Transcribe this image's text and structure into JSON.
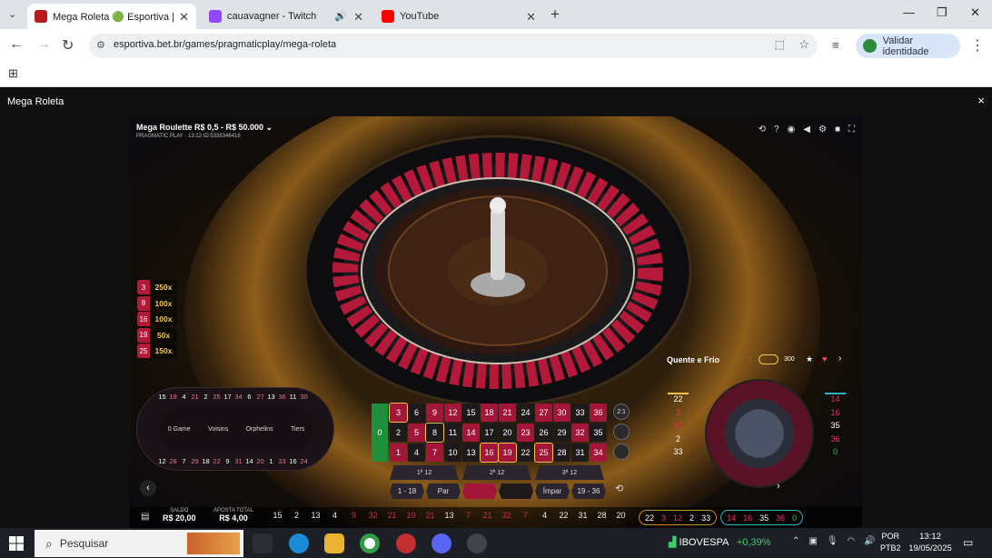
{
  "browser": {
    "tabs": [
      {
        "title": "Mega Roleta 🟢 Esportiva |",
        "active": true,
        "fav": "#b71c1c"
      },
      {
        "title": "cauavagner - Twitch",
        "active": false,
        "fav": "#9146ff"
      },
      {
        "title": "YouTube",
        "active": false,
        "fav": "#ff0000"
      }
    ],
    "url": "esportiva.bet.br/games/pragmaticplay/mega-roleta",
    "validar": "Validar identidade"
  },
  "page": {
    "title": "Mega Roleta",
    "close": "×"
  },
  "game": {
    "stake": "Mega Roulette R$ 0,5 - R$ 50.000 ⌄",
    "subtitle": "PRAGMATIC PLAY · 13:12 ID:5338346416",
    "multipliers": [
      {
        "n": "3",
        "v": "250x"
      },
      {
        "n": "8",
        "v": "100x"
      },
      {
        "n": "16",
        "v": "100x"
      },
      {
        "n": "19",
        "v": "50x"
      },
      {
        "n": "25",
        "v": "150x"
      }
    ],
    "racetrack": {
      "sections": [
        "0 Game",
        "Voisins",
        "Orphelins",
        "Tiers"
      ]
    },
    "grid": {
      "zero": "0",
      "rows": [
        [
          "3",
          "6",
          "9",
          "12",
          "15",
          "18",
          "21",
          "24",
          "27",
          "30",
          "33",
          "36"
        ],
        [
          "2",
          "5",
          "8",
          "11",
          "14",
          "17",
          "20",
          "23",
          "26",
          "29",
          "32",
          "35"
        ],
        [
          "1",
          "4",
          "7",
          "10",
          "13",
          "16",
          "19",
          "22",
          "25",
          "28",
          "31",
          "34"
        ]
      ],
      "column": "2:1",
      "dozens": [
        "1ª 12",
        "2ª 12",
        "3ª 12"
      ],
      "even": [
        "1 - 18",
        "Par",
        "",
        "",
        "Ímpar",
        "19 - 36"
      ]
    },
    "hotcold": {
      "title": "Quente e Frio",
      "count": "300",
      "hot": [
        "22",
        "3",
        "12",
        "2",
        "33"
      ],
      "cold": [
        "14",
        "16",
        "35",
        "36",
        "0"
      ]
    },
    "saldo_label": "SALDO",
    "saldo": "R$ 20,00",
    "aposta_label": "APOSTA TOTAL",
    "aposta": "R$ 4,00",
    "history": [
      {
        "n": "15",
        "c": "hblk"
      },
      {
        "n": "2",
        "c": "hblk"
      },
      {
        "n": "13",
        "c": "hblk"
      },
      {
        "n": "4",
        "c": "hblk"
      },
      {
        "n": "9",
        "c": "hred"
      },
      {
        "n": "32",
        "c": "hred"
      },
      {
        "n": "21",
        "c": "hred"
      },
      {
        "n": "19",
        "c": "hred"
      },
      {
        "n": "21",
        "c": "hred"
      },
      {
        "n": "13",
        "c": "hblk"
      },
      {
        "n": "7",
        "c": "hred"
      },
      {
        "n": "21",
        "c": "hred"
      },
      {
        "n": "32",
        "c": "hred"
      },
      {
        "n": "7",
        "c": "hred"
      },
      {
        "n": "4",
        "c": "hblk"
      },
      {
        "n": "22",
        "c": "hblk"
      },
      {
        "n": "31",
        "c": "hblk"
      },
      {
        "n": "28",
        "c": "hblk"
      },
      {
        "n": "20",
        "c": "hblk"
      }
    ],
    "hotpill": [
      "22",
      "3",
      "12",
      "2",
      "33"
    ],
    "coldpill": [
      "14",
      "16",
      "35",
      "36",
      "0"
    ]
  },
  "taskbar": {
    "search": "Pesquisar",
    "ibov": "IBOVESPA",
    "ibov_change": "+0,39%",
    "lang1": "POR",
    "lang2": "PTB2",
    "time": "13:12",
    "date": "19/05/2025"
  }
}
